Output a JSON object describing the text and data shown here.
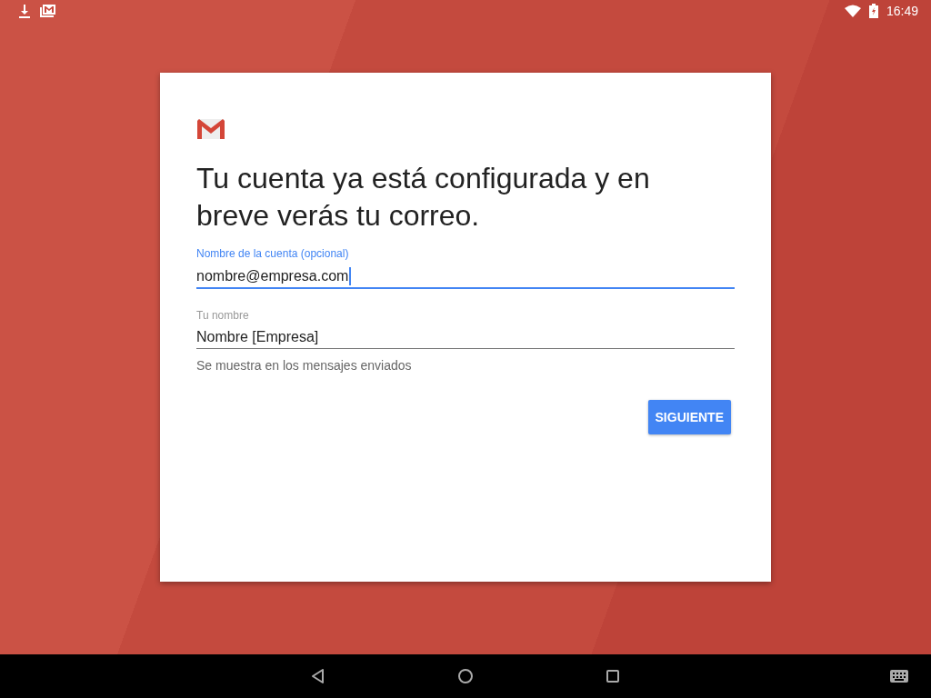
{
  "status_bar": {
    "time": "16:49"
  },
  "card": {
    "title": "Tu cuenta ya está configurada y en breve verás tu correo.",
    "fields": [
      {
        "label": "Nombre de la cuenta (opcional)",
        "value": "nombre@empresa.com",
        "focused": true
      },
      {
        "label": "Tu nombre",
        "value": "Nombre [Empresa]",
        "focused": false,
        "helper": "Se muestra en los mensajes enviados"
      }
    ],
    "button": "SIGUIENTE"
  }
}
